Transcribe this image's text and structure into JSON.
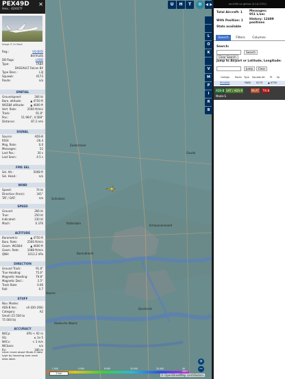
{
  "info": {
    "callsign": "PEX49D",
    "hex_label": "Hex.:",
    "hex_value": "42447F",
    "photo_caption": "Image © Gr Mout",
    "close": "✕",
    "rows_top": [
      {
        "l": "Reg.:",
        "v": "VQ-BXD"
      },
      {
        "l": "",
        "v": "Bermuda"
      },
      {
        "l": "DB flags:",
        "v": "LADD"
      },
      {
        "l": "Type:",
        "v": "FA8X"
      },
      {
        "l": "",
        "v": "DASSAULT Falcon 8X"
      },
      {
        "l": "Type Desc.:",
        "v": "L3J"
      },
      {
        "l": "Squawk:",
        "v": "0173"
      },
      {
        "l": "Route:",
        "v": "n/a"
      }
    ],
    "spatial_title": "SPATIAL",
    "spatial": [
      {
        "l": "Groundspeed:",
        "v": "266 kt"
      },
      {
        "l": "Baro. altitude:",
        "v": "▲ 4750 ft"
      },
      {
        "l": "WGS84 altitude:",
        "v": "▲ 4600 ft"
      },
      {
        "l": "Vert. Rate:",
        "v": "2560 ft/min"
      },
      {
        "l": "Track:",
        "v": "91.8°"
      },
      {
        "l": "Pos.:",
        "v": "51.964°, 4.568°"
      },
      {
        "l": "Distance:",
        "v": "87.2 nmi"
      }
    ],
    "signal_title": "SIGNAL",
    "signal": [
      {
        "l": "Source:",
        "v": "ADS-B"
      },
      {
        "l": "RSSI:",
        "v": "-26.4"
      },
      {
        "l": "Msg. Rate:",
        "v": "0.0"
      },
      {
        "l": "Messages:",
        "v": "52"
      },
      {
        "l": "Last Pos.:",
        "v": "30 s"
      },
      {
        "l": "Last Seen:",
        "v": "4.5 s"
      }
    ],
    "fms_title": "FMS SEL",
    "fms": [
      {
        "l": "Sel. Alt.:",
        "v": "5008 ft"
      },
      {
        "l": "Sel. Head.:",
        "v": "n/a"
      }
    ],
    "wind_title": "WIND",
    "wind": [
      {
        "l": "Speed:",
        "v": "74 kt"
      },
      {
        "l": "Direction (from):",
        "v": "341°"
      },
      {
        "l": "TAT / OAT:",
        "v": "n/a"
      }
    ],
    "speed_title": "SPEED",
    "speed": [
      {
        "l": "Ground:",
        "v": "266 kt"
      },
      {
        "l": "True:",
        "v": "250 kt"
      },
      {
        "l": "Indicated:",
        "v": "230 kt"
      },
      {
        "l": "Mach:",
        "v": "0.376"
      }
    ],
    "altitude_title": "ALTITUDE",
    "altitude": [
      {
        "l": "Barometric:",
        "v": "▲ 4750 ft"
      },
      {
        "l": "Baro. Rate:",
        "v": "2560 ft/min"
      },
      {
        "l": "Geom. WGS84:",
        "v": "▲ 4600 ft"
      },
      {
        "l": "Geom. Rate:",
        "v": "1088 ft/min"
      },
      {
        "l": "QNH:",
        "v": "1013.2 hPa"
      }
    ],
    "direction_title": "DIRECTION",
    "direction": [
      {
        "l": "Ground Track:",
        "v": "91.8°"
      },
      {
        "l": "True Heading:",
        "v": "75.6°"
      },
      {
        "l": "Magnetic Heading:",
        "v": "79.8°"
      },
      {
        "l": "Magnetic Decl.:",
        "v": "2.5°"
      },
      {
        "l": "Track Rate:",
        "v": "0.06"
      },
      {
        "l": "Roll:",
        "v": "0.7"
      }
    ],
    "stuff_title": "STUFF",
    "stuff": [
      {
        "l": "Nav. Modes:",
        "v": ""
      },
      {
        "l": "ADS-B Ver.:",
        "v": "v0 (DO-260)"
      },
      {
        "l": "Category:",
        "v": "A2"
      },
      {
        "l": "Small (15 500 to",
        "v": ""
      },
      {
        "l": "75 000 lb)",
        "v": ""
      }
    ],
    "accuracy_title": "ACCURACY",
    "accuracy": [
      {
        "l": "NACp:",
        "v": "EPU < 92 m"
      },
      {
        "l": "SIL:",
        "v": "≤ 1e-5"
      },
      {
        "l": "NACv:",
        "v": "< 3 m/s"
      },
      {
        "l": "NICbaro:",
        "v": "n/a"
      },
      {
        "l": "Rc:",
        "v": "186 m"
      }
    ],
    "footer": "Learn more about Mode-S data type by hovering over each data label."
  },
  "toolbar": {
    "back": "◀",
    "forward": "▶",
    "u": "U",
    "h": "H",
    "t": "T",
    "settings": "⚙"
  },
  "mapbuttons": [
    "",
    "",
    "L",
    "O",
    "K",
    "",
    "V",
    "M",
    "P",
    "I",
    "R",
    "B"
  ],
  "side": {
    "version": "tar1090 on github (3.14.1751)",
    "total_label": "Total Aircraft: 1",
    "messages_label": "Messages:",
    "messages_value": "951 L/sec",
    "position_label": "With Position: 1",
    "history_label": "History: 12499 positions",
    "stats": "Stats available",
    "tabs": [
      "Search",
      "Filters",
      "Columns"
    ],
    "search_label": "Search:",
    "search_button": "Search",
    "clear_search": "Clear Search",
    "jump_label": "Jump to Airport or Latitude, Longitude:",
    "jump_button": "Jump",
    "clear_button": "Clear",
    "columns": [
      "Callsign",
      "Route",
      "Type",
      "Squawk",
      "Alt.",
      "Pt",
      "Sp"
    ],
    "row": {
      "callsign": "PEX49D",
      "type": "FA8X",
      "squawk": "0173",
      "alt": "▲ 4750"
    },
    "tags": [
      "ADS-B",
      "UAT / ADS-R",
      "MLAT",
      "TIS-B"
    ],
    "modes": "Mode-S"
  },
  "map": {
    "zoom_in": "+",
    "zoom_out": "−",
    "scale": "2 km",
    "attribution": "© OpenStreetMap contributors.",
    "legend_ticks": [
      "2 000",
      "4 000",
      "6 000",
      "10 000",
      "20 000",
      "40 000+"
    ],
    "places": [
      "Zoetermeer",
      "Rotterdam",
      "Krimpenerwaard",
      "Gouda",
      "Dordrecht",
      "Hoeksche Waard",
      "Voorne",
      "Barendrecht",
      "Schiedam"
    ]
  }
}
